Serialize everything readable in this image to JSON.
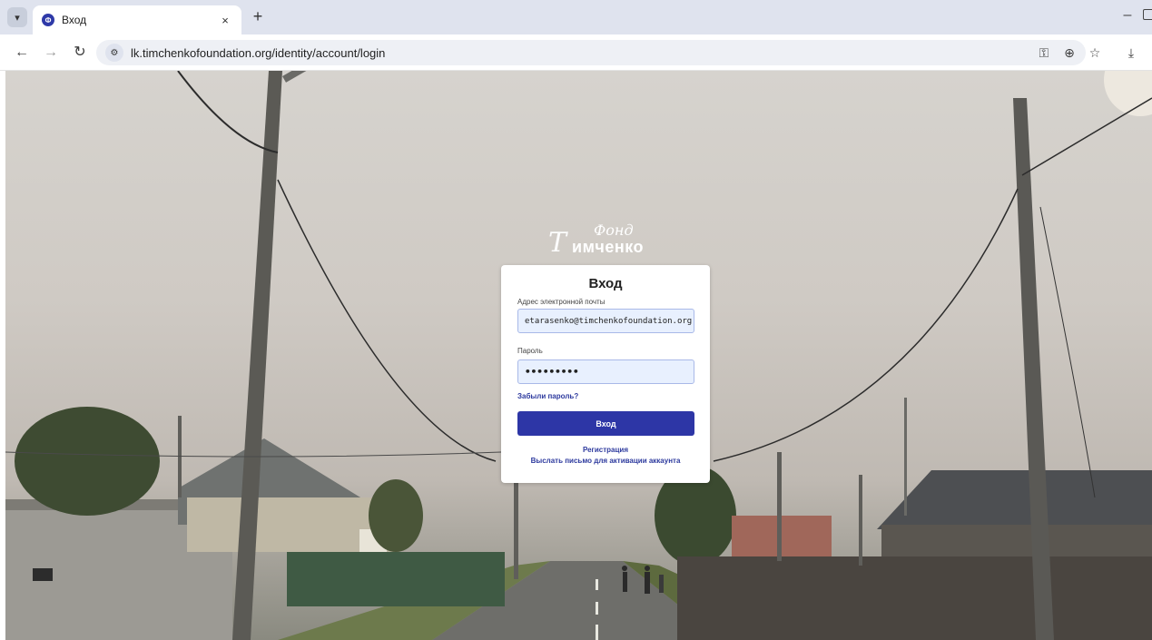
{
  "browser": {
    "tab": {
      "title": "Вход",
      "close": "×",
      "favicon_text": "Ф"
    },
    "new_tab": "+",
    "url": "lk.timchenkofoundation.org/identity/account/login",
    "icons": [
      "tab-menu-icon",
      "back-icon",
      "forward-icon",
      "reload-icon",
      "site-info-icon",
      "password-key-icon",
      "zoom-icon",
      "bookmark-star-icon",
      "download-icon"
    ]
  },
  "logo": {
    "top": "Фонд",
    "bottom": "имченко",
    "initial": "Т"
  },
  "login": {
    "title": "Вход",
    "email_label": "Адрес электронной почты",
    "email_value": "etarasenko@timchenkofoundation.org",
    "password_label": "Пароль",
    "password_value": "•••••••••",
    "forgot_link": "Забыли пароль?",
    "submit_label": "Вход",
    "register_link": "Регистрация",
    "activation_link": "Выслать письмо для активации аккаунта"
  },
  "colors": {
    "accent": "#2d36a6",
    "link": "#2d3a9e",
    "input_bg": "#e8f0fe"
  }
}
